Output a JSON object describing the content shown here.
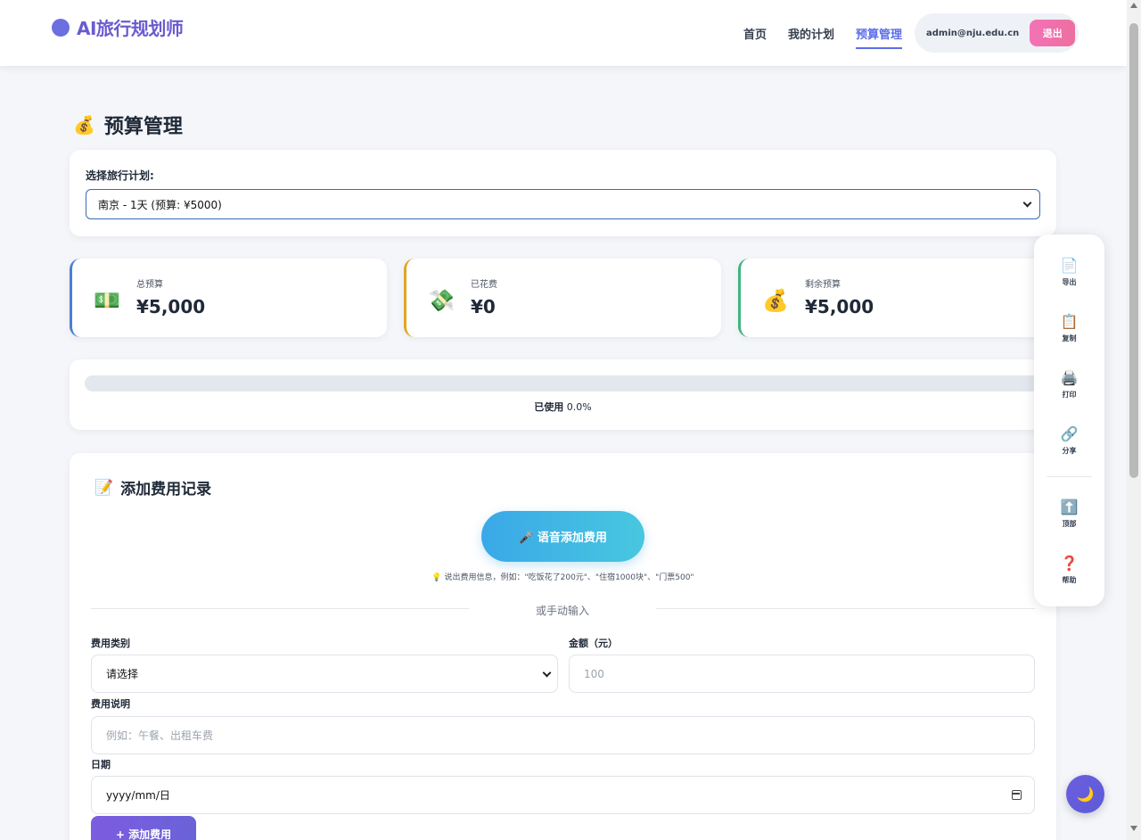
{
  "header": {
    "brand": "AI旅行规划师",
    "nav": [
      "首页",
      "我的计划",
      "预算管理"
    ],
    "active_nav": "预算管理",
    "user_email": "admin@nju.edu.cn",
    "logout": "退出"
  },
  "page": {
    "title_icon": "💰",
    "title": "预算管理"
  },
  "plan": {
    "label": "选择旅行计划:",
    "selected": "南京 - 1天 (预算: ¥5000)"
  },
  "stats": [
    {
      "icon": "💵",
      "label": "总预算",
      "value": "¥5,000"
    },
    {
      "icon": "💸",
      "label": "已花费",
      "value": "¥0"
    },
    {
      "icon": "💰",
      "label": "剩余预算",
      "value": "¥5,000"
    }
  ],
  "progress": {
    "label": "已使用",
    "value_text": "0.0%",
    "fraction": 0.0
  },
  "form": {
    "title_icon": "📝",
    "title": "添加费用记录",
    "voice_button": "🎤 语音添加费用",
    "voice_hint": "💡 说出费用信息，例如：\"吃饭花了200元\"、\"住宿1000块\"、\"门票500\"",
    "divider": "或手动输入",
    "category_label": "费用类别",
    "category_value": "请选择",
    "amount_label": "金额（元）",
    "amount_placeholder": "100",
    "desc_label": "费用说明",
    "desc_placeholder": "例如：午餐、出租车费",
    "date_label": "日期",
    "date_placeholder": "yyyy/mm/日",
    "submit": "+ 添加费用"
  },
  "toolbar": [
    {
      "icon": "📄",
      "label": "导出"
    },
    {
      "icon": "📋",
      "label": "复制"
    },
    {
      "icon": "🖨️",
      "label": "打印"
    },
    {
      "icon": "🔗",
      "label": "分享"
    },
    {
      "icon": "⬆️",
      "label": "顶部"
    },
    {
      "icon": "❓",
      "label": "帮助"
    }
  ],
  "theme_toggle_icon": "🌙",
  "colors": {
    "brand": "#6a5ccf",
    "accent": "#5b6ee8",
    "logout": "#ec6fa0",
    "stat_total": "#4a7fd6",
    "stat_spent": "#e0a526",
    "stat_remaining": "#3fb47f"
  }
}
